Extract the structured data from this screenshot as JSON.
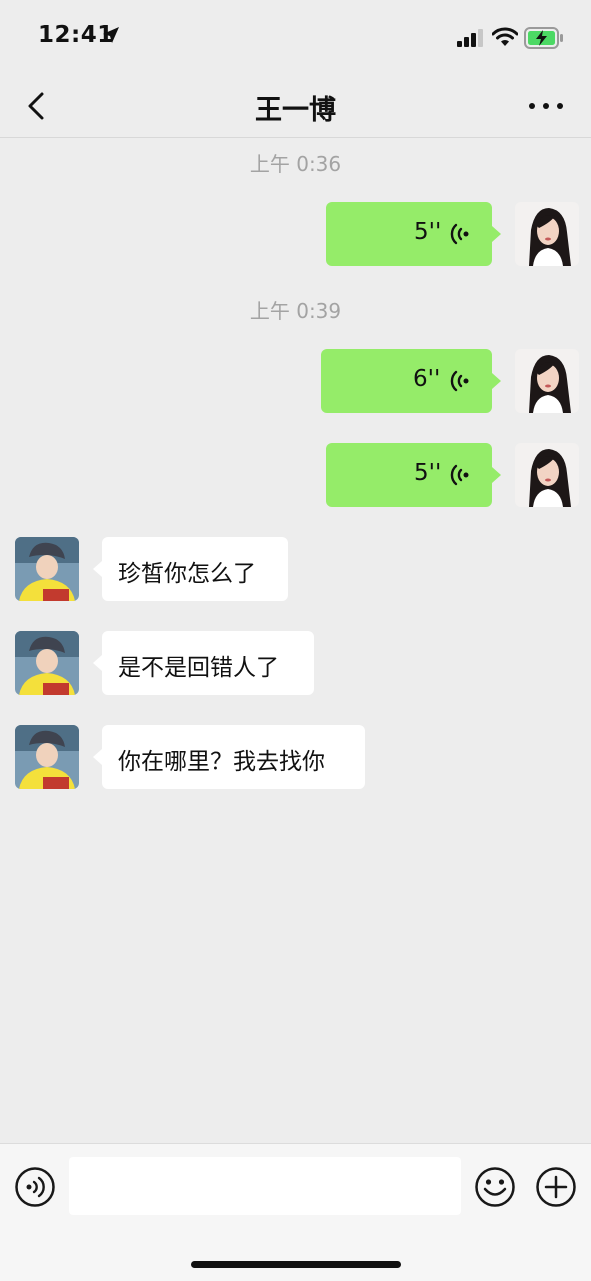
{
  "status_bar": {
    "time": "12:41"
  },
  "header": {
    "title": "王一博"
  },
  "messages": [
    {
      "type": "timestamp",
      "text": "上午 0:36"
    },
    {
      "type": "voice",
      "direction": "out",
      "duration": "5''"
    },
    {
      "type": "timestamp",
      "text": "上午 0:39"
    },
    {
      "type": "voice",
      "direction": "out",
      "duration": "6''"
    },
    {
      "type": "voice",
      "direction": "out",
      "duration": "5''"
    },
    {
      "type": "text",
      "direction": "in",
      "text": "珍皙你怎么了"
    },
    {
      "type": "text",
      "direction": "in",
      "text": "是不是回错人了"
    },
    {
      "type": "text",
      "direction": "in",
      "text": "你在哪里？我去找你"
    }
  ],
  "input_bar": {
    "value": "",
    "placeholder": ""
  },
  "colors": {
    "background": "#ededed",
    "outgoing_bubble": "#95ec69",
    "incoming_bubble": "#ffffff",
    "timestamp_text": "#a3a3a3",
    "battery_charge": "#4cd964"
  },
  "icons": [
    "location-arrow-icon",
    "cellular-signal-icon",
    "wifi-icon",
    "battery-charging-icon",
    "back-chevron-icon",
    "more-dots-icon",
    "voice-wave-icon",
    "voice-input-icon",
    "emoji-icon",
    "plus-icon"
  ]
}
